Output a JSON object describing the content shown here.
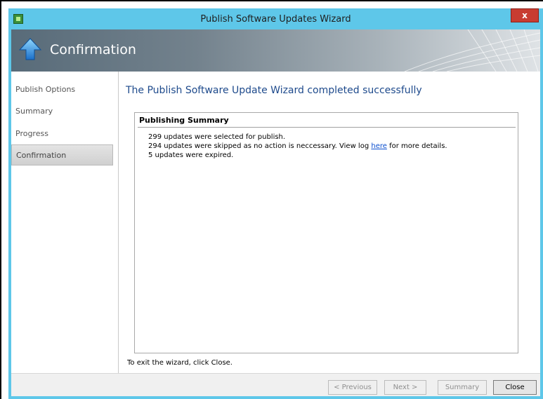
{
  "window": {
    "title": "Publish Software Updates Wizard",
    "close_label": "x"
  },
  "header": {
    "title": "Confirmation"
  },
  "sidebar": {
    "items": [
      {
        "label": "Publish Options"
      },
      {
        "label": "Summary"
      },
      {
        "label": "Progress"
      },
      {
        "label": "Confirmation",
        "active": true
      }
    ]
  },
  "main": {
    "heading": "The Publish Software Update Wizard completed successfully",
    "summary": {
      "title": "Publishing Summary",
      "line1": "299 updates were selected for publish.",
      "line2_prefix": "294 updates were skipped as no action is neccessary. View log ",
      "line2_link": "here",
      "line2_suffix": " for more details.",
      "line3": "5 updates were expired."
    },
    "exit_text": "To exit the wizard, click Close."
  },
  "footer": {
    "previous_label": "< Previous",
    "next_label": "Next >",
    "summary_label": "Summary",
    "close_label": "Close"
  },
  "colors": {
    "titlebar": "#5ec7e9",
    "heading_blue": "#1e4a8c",
    "link_blue": "#0b4fcf",
    "close_red": "#c83c31"
  }
}
